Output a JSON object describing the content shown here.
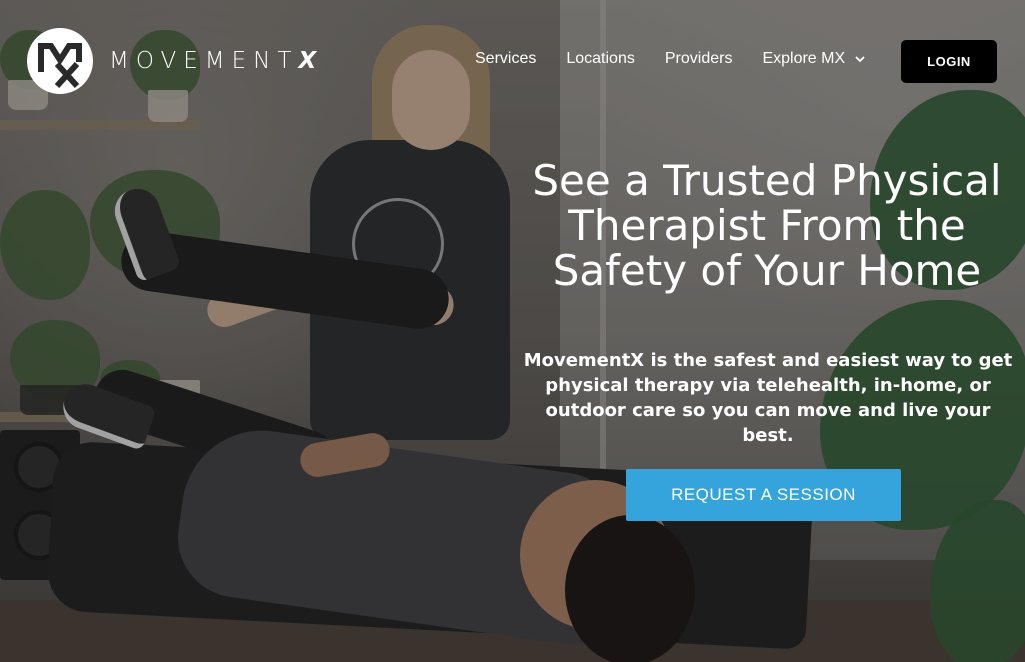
{
  "brand": {
    "logo_mark": "MX",
    "name_main": "MOVEMENT",
    "name_accent": "X"
  },
  "nav": {
    "items": [
      {
        "label": "Services"
      },
      {
        "label": "Locations"
      },
      {
        "label": "Providers"
      },
      {
        "label": "Explore MX",
        "icon": "chevron-down-icon"
      }
    ],
    "login_label": "LOGIN"
  },
  "hero": {
    "headline": "See a Trusted Physical Therapist From the Safety of Your Home",
    "subtext": "MovementX is the safest and easiest way to get physical therapy via telehealth, in-home, or outdoor care so you can move and live your best.",
    "cta_label": "REQUEST A SESSION"
  },
  "colors": {
    "cta": "#35a3dc",
    "login_bg": "#000000",
    "text": "#ffffff"
  }
}
